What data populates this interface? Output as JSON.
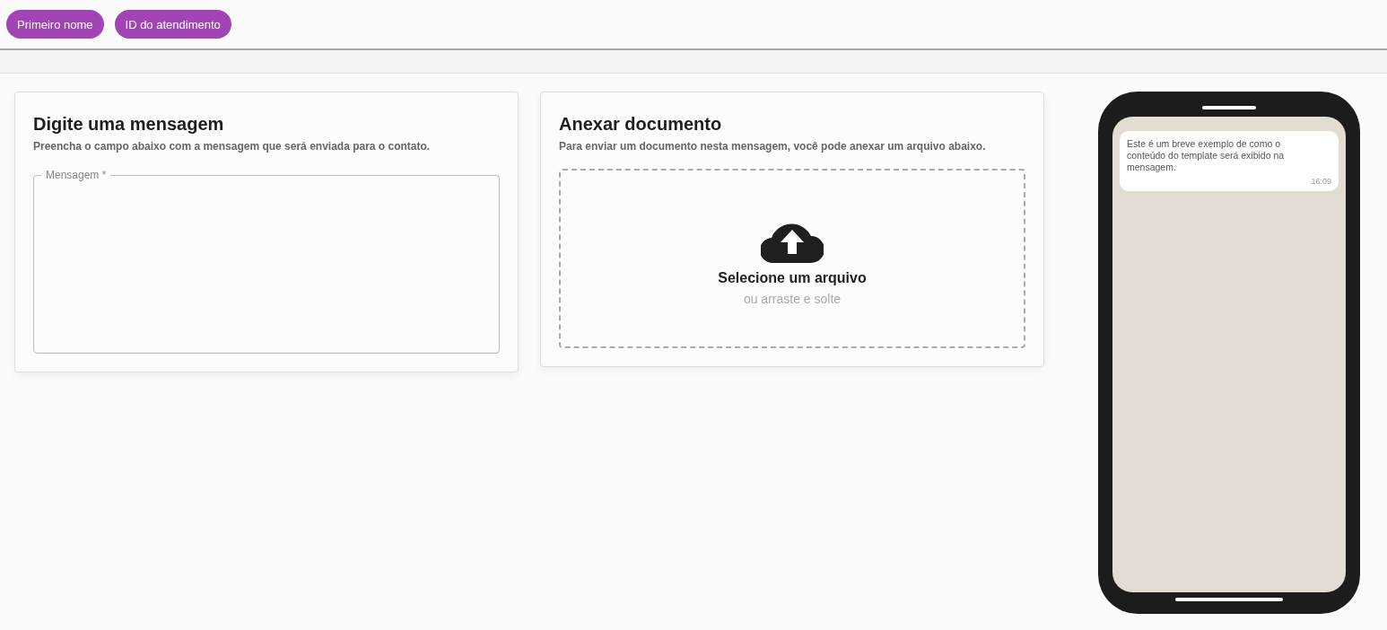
{
  "variable_chips": [
    {
      "label": "Primeiro nome"
    },
    {
      "label": "ID do atendimento"
    }
  ],
  "message_card": {
    "title": "Digite uma mensagem",
    "description": "Preencha o campo abaixo com a mensagem que será enviada para o contato.",
    "field": {
      "label": "Mensagem *"
    }
  },
  "attach_card": {
    "title": "Anexar documento",
    "description": "Para enviar um documento nesta mensagem, você pode anexar um arquivo abaixo.",
    "dropzone": {
      "title": "Selecione um arquivo",
      "subtitle": "ou arraste e solte"
    }
  },
  "phone_preview": {
    "message": "Este é um breve exemplo de como o conteúdo do template será exibido na mensagem.",
    "time": "16:09"
  }
}
